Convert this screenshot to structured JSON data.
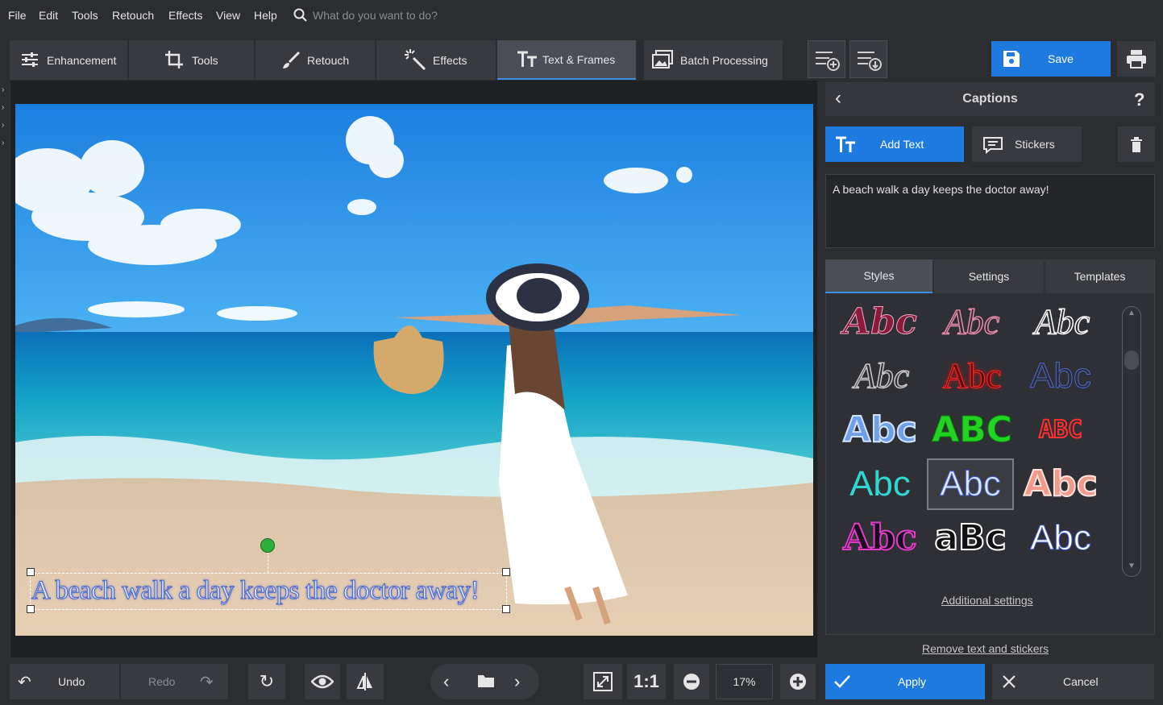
{
  "menu": {
    "items": [
      "File",
      "Edit",
      "Tools",
      "Retouch",
      "Effects",
      "View",
      "Help"
    ],
    "search_placeholder": "What do you want to do?"
  },
  "tabs": [
    {
      "label": "Enhancement",
      "icon": "sliders-icon"
    },
    {
      "label": "Tools",
      "icon": "crop-icon"
    },
    {
      "label": "Retouch",
      "icon": "brush-icon"
    },
    {
      "label": "Effects",
      "icon": "magic-wand-icon"
    },
    {
      "label": "Text & Frames",
      "icon": "text-icon",
      "active": true
    },
    {
      "label": "Batch Processing",
      "icon": "images-icon"
    }
  ],
  "toolbar": {
    "save_label": "Save"
  },
  "canvas": {
    "caption_text": "A beach walk a day keeps the doctor away!"
  },
  "panel": {
    "title": "Captions",
    "help": "?",
    "add_text_label": "Add Text",
    "stickers_label": "Stickers",
    "text_value": "A beach walk a day keeps the doctor away!",
    "subtabs": [
      "Styles",
      "Settings",
      "Templates"
    ],
    "styles": [
      "Abc",
      "Abc",
      "Abc",
      "Abc",
      "Abc",
      "Abc",
      "Abc",
      "ABC",
      "ABC",
      "Abc",
      "Abc",
      "Abc",
      "Abc",
      "aBc",
      "Abc"
    ],
    "additional_settings": "Additional settings",
    "remove_link": "Remove text and stickers"
  },
  "bottom": {
    "undo": "Undo",
    "redo": "Redo",
    "one_to_one": "1:1",
    "zoom": "17%",
    "apply": "Apply",
    "cancel": "Cancel"
  },
  "colors": {
    "accent": "#1f7ae0",
    "bg": "#2b2d31"
  }
}
